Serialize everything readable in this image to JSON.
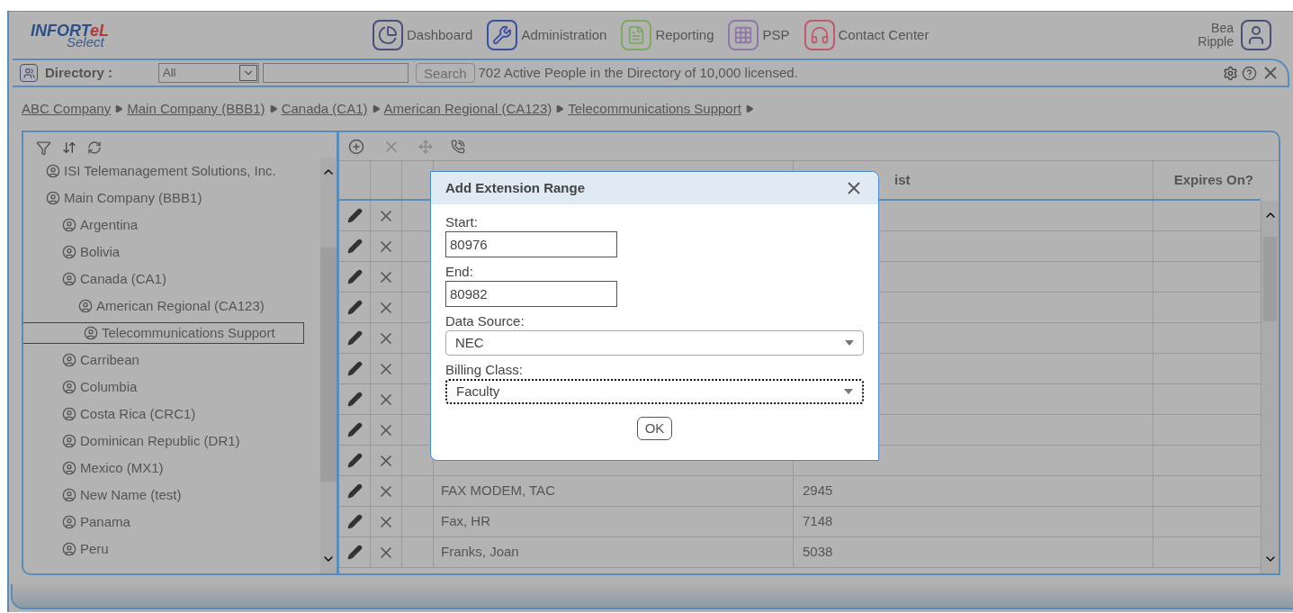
{
  "header": {
    "logo": {
      "main": "INFORT",
      "accent": "eL",
      "sub": "Select"
    },
    "nav": [
      {
        "kind": "dashboard",
        "label": "Dashboard"
      },
      {
        "kind": "administration",
        "label": "Administration"
      },
      {
        "kind": "reporting",
        "label": "Reporting"
      },
      {
        "kind": "psp",
        "label": "PSP"
      },
      {
        "kind": "contact",
        "label": "Contact Center"
      }
    ],
    "user": {
      "name": "Bea Ripple"
    }
  },
  "directory_bar": {
    "label": "Directory :",
    "scope": "All",
    "search_button": "Search",
    "status": "702 Active People in the Directory of 10,000 licensed."
  },
  "breadcrumb": [
    "ABC Company",
    "Main Company (BBB1)",
    "Canada (CA1)",
    "American Regional (CA123)",
    "Telecommunications Support"
  ],
  "tree": [
    {
      "label": "ISI Telemanagement Solutions, Inc.",
      "selected": false
    },
    {
      "label": "Main Company (BBB1)",
      "selected": false,
      "children": [
        {
          "label": "Argentina",
          "selected": false
        },
        {
          "label": "Bolivia",
          "selected": false
        },
        {
          "label": "Canada (CA1)",
          "selected": false,
          "children": [
            {
              "label": "American Regional (CA123)",
              "selected": false,
              "children": [
                {
                  "label": "Telecommunications Support",
                  "selected": true
                }
              ]
            }
          ]
        },
        {
          "label": "Carribean",
          "selected": false
        },
        {
          "label": "Columbia",
          "selected": false
        },
        {
          "label": "Costa Rica (CRC1)",
          "selected": false
        },
        {
          "label": "Dominican Republic (DR1)",
          "selected": false
        },
        {
          "label": "Mexico (MX1)",
          "selected": false
        },
        {
          "label": "New Name (test)",
          "selected": false
        },
        {
          "label": "Panama",
          "selected": false
        },
        {
          "label": "Peru",
          "selected": false
        }
      ]
    }
  ],
  "table": {
    "columns": [
      "ist",
      "Expires On?"
    ],
    "rows": [
      {
        "kind": "covered"
      },
      {
        "kind": "covered"
      },
      {
        "kind": "covered"
      },
      {
        "kind": "covered"
      },
      {
        "kind": "covered"
      },
      {
        "kind": "covered"
      },
      {
        "kind": "covered"
      },
      {
        "kind": "covered"
      },
      {
        "kind": "covered"
      },
      {
        "kind": "entry",
        "name": "FAX MODEM, TAC",
        "extension": "2945"
      },
      {
        "kind": "entry",
        "name": "Fax, HR",
        "extension": "7148"
      },
      {
        "kind": "entry",
        "name": "Franks, Joan",
        "extension": "5038"
      }
    ]
  },
  "dialog": {
    "title": "Add Extension Range",
    "fields": [
      {
        "kind": "text",
        "label": "Start:",
        "value": "80976",
        "focused": false
      },
      {
        "kind": "text",
        "label": "End:",
        "value": "80982",
        "focused": false
      },
      {
        "kind": "select",
        "label": "Data Source:",
        "value": "NEC",
        "focused": false
      },
      {
        "kind": "select",
        "label": "Billing Class:",
        "value": "Faculty",
        "focused": true
      }
    ],
    "ok": "OK"
  }
}
